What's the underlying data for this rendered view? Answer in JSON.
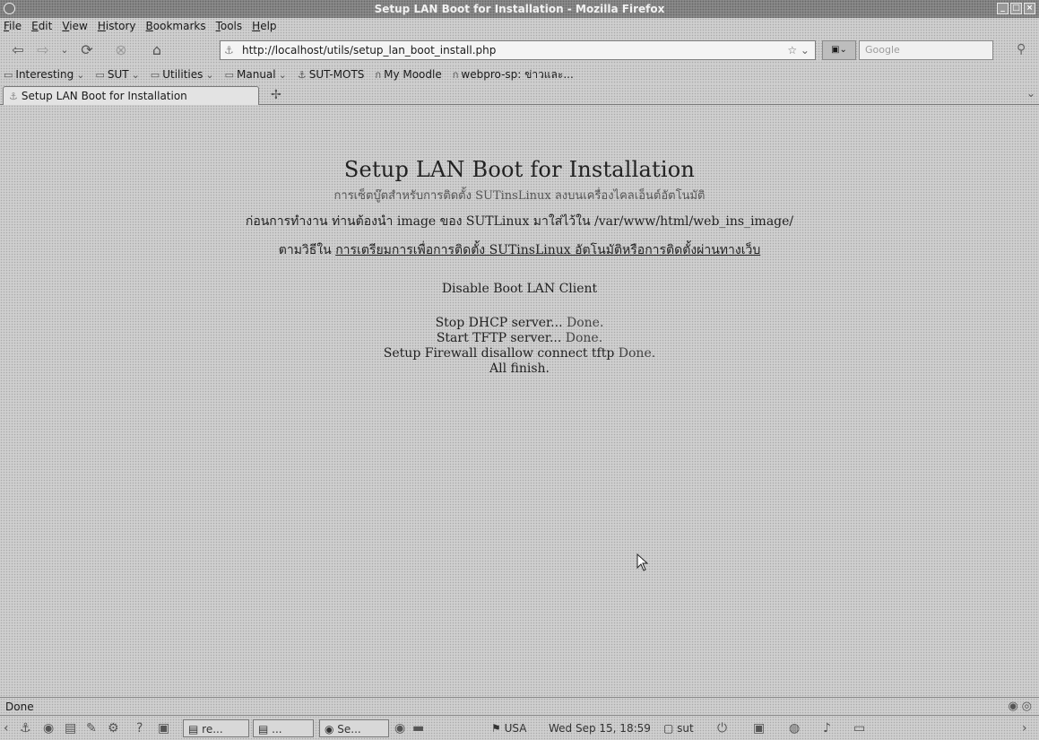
{
  "window": {
    "title": "Setup LAN Boot for Installation - Mozilla Firefox",
    "minimize": "_",
    "maximize": "□",
    "close": "×"
  },
  "menu": [
    "File",
    "Edit",
    "View",
    "History",
    "Bookmarks",
    "Tools",
    "Help"
  ],
  "nav": {
    "url": "http://localhost/utils/setup_lan_boot_install.php",
    "search_placeholder": "Google"
  },
  "bookmarks": [
    {
      "label": "Interesting",
      "icon": "folder-icon"
    },
    {
      "label": "SUT",
      "icon": "folder-icon"
    },
    {
      "label": "Utilities",
      "icon": "folder-icon"
    },
    {
      "label": "Manual",
      "icon": "folder-icon"
    },
    {
      "label": "SUT-MOTS",
      "icon": "page-icon"
    },
    {
      "label": "My Moodle",
      "icon": "page-icon"
    },
    {
      "label": "webpro-sp: ข่าวและ...",
      "icon": "page-icon"
    }
  ],
  "tab": {
    "label": "Setup LAN Boot for Installation"
  },
  "page": {
    "title": "Setup LAN Boot for Installation",
    "subtitle": "การเซ็ตบู๊ตสำหรับการติดตั้ง SUTinsLinux ลงบนเครื่องไคลเอ็นต์อัตโนมัติ",
    "line2": "ก่อนการทำงาน ท่านต้องนำ image ของ SUTLinux มาใส่ไว้ใน /var/www/html/web_ins_image/",
    "line3_prefix": "ตามวิธีใน",
    "line3_link": "การเตรียมการเพื่อการติดตั้ง SUTinsLinux อัตโนมัติหรือการติดตั้งผ่านทางเว็บ",
    "section": "Disable Boot LAN Client",
    "status": [
      {
        "label": "Stop DHCP server...",
        "result": "Done."
      },
      {
        "label": "Start TFTP server...",
        "result": "Done."
      },
      {
        "label": "Setup Firewall disallow connect tftp",
        "result": "Done."
      },
      {
        "label": "All finish.",
        "result": ""
      }
    ]
  },
  "statusbar": {
    "text": "Done"
  },
  "taskbar": {
    "tasks": [
      "re...",
      "...",
      "Se..."
    ],
    "keyboard": "USA",
    "clock": "Wed Sep 15, 18:59",
    "user": "sut"
  }
}
